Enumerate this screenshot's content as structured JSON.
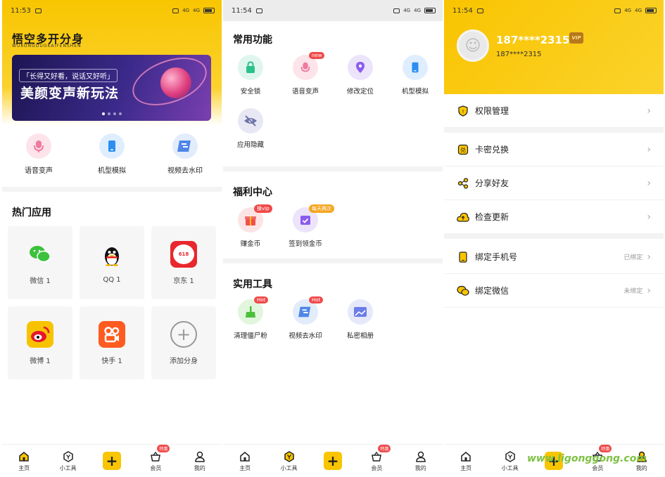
{
  "status_bars": [
    {
      "time": "11:53",
      "network": "4G"
    },
    {
      "time": "11:54",
      "network": "4G"
    },
    {
      "time": "11:54",
      "network": "4G"
    }
  ],
  "home": {
    "app_name": "悟空多开分身",
    "app_name_pinyin": "WUKONGDUOKAIFENSHEN",
    "banner": {
      "quote": "「长得又好看，说话又好听」",
      "title": "美颜变声新玩法",
      "page_count": 4,
      "active_page": 1
    },
    "quick_actions": [
      {
        "label": "语音变声",
        "icon": "microphone-icon"
      },
      {
        "label": "机型模拟",
        "icon": "phone-icon"
      },
      {
        "label": "视频去水印",
        "icon": "video-watermark-icon"
      }
    ],
    "hot_apps_title": "热门应用",
    "hot_apps": [
      {
        "label": "微信  1",
        "icon": "wechat-icon"
      },
      {
        "label": "QQ  1",
        "icon": "qq-penguin-icon"
      },
      {
        "label": "京东  1",
        "icon": "jd-icon",
        "icon_text": "618"
      },
      {
        "label": "微博  1",
        "icon": "weibo-icon"
      },
      {
        "label": "快手  1",
        "icon": "kuaishou-icon"
      },
      {
        "label": "添加分身",
        "icon": "add-icon"
      }
    ]
  },
  "tools": {
    "common_title": "常用功能",
    "common": [
      {
        "label": "安全锁",
        "icon": "lock-icon"
      },
      {
        "label": "语音变声",
        "icon": "microphone-icon",
        "badge": "new"
      },
      {
        "label": "修改定位",
        "icon": "location-pin-icon"
      },
      {
        "label": "机型模拟",
        "icon": "phone-icon"
      },
      {
        "label": "应用隐藏",
        "icon": "eye-hidden-icon"
      }
    ],
    "welfare_title": "福利中心",
    "welfare": [
      {
        "label": "赚金币",
        "icon": "gift-icon",
        "badge": "换vip"
      },
      {
        "label": "签到领金币",
        "icon": "calendar-check-icon",
        "badge": "每天两次"
      }
    ],
    "utility_title": "实用工具",
    "utility": [
      {
        "label": "清理僵尸粉",
        "icon": "broom-icon",
        "badge": "Hot"
      },
      {
        "label": "视频去水印",
        "icon": "video-watermark-icon",
        "badge": "Hot"
      },
      {
        "label": "私密相册",
        "icon": "private-album-icon"
      }
    ]
  },
  "profile": {
    "username": "187****2315",
    "phone": "187****2315",
    "vip_label": "VIP",
    "menu_groups": [
      [
        {
          "label": "权限管理",
          "icon": "shield-icon"
        }
      ],
      [
        {
          "label": "卡密兑换",
          "icon": "exchange-icon"
        },
        {
          "label": "分享好友",
          "icon": "share-icon"
        },
        {
          "label": "检查更新",
          "icon": "cloud-upload-icon"
        }
      ],
      [
        {
          "label": "绑定手机号",
          "icon": "phone-icon",
          "status": "已绑定"
        },
        {
          "label": "绑定微信",
          "icon": "wechat-icon",
          "status": "未绑定"
        }
      ]
    ]
  },
  "bottom_nav": [
    {
      "label": "主页",
      "icon": "home-icon"
    },
    {
      "label": "小工具",
      "icon": "tools-icon"
    },
    {
      "label": "",
      "icon": "plus-icon"
    },
    {
      "label": "会员",
      "icon": "basket-icon",
      "badge": "特惠"
    },
    {
      "label": "我的",
      "icon": "user-icon"
    }
  ],
  "watermark": "www.ligonggong.com",
  "colors": {
    "brand_yellow": "#f8c500",
    "badge_red": "#f04a4a",
    "badge_orange": "#f5a623",
    "watermark_green": "#7dc142"
  }
}
